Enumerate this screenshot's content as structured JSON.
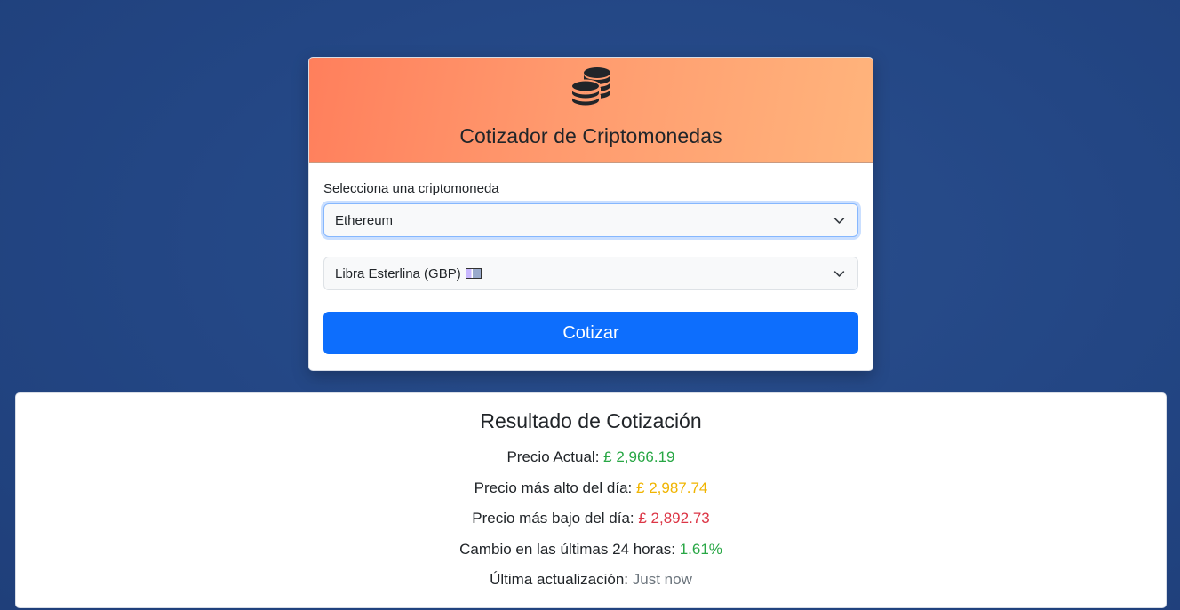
{
  "form": {
    "title": "Cotizador de Criptomonedas",
    "icon": "coins-icon",
    "crypto_label": "Selecciona una criptomoneda",
    "crypto_selected": "Ethereum",
    "currency_selected": "Libra Esterlina (GBP)",
    "submit_label": "Cotizar"
  },
  "result": {
    "title": "Resultado de Cotización",
    "rows": [
      {
        "label": "Precio Actual:",
        "value": "£ 2,966.19",
        "color": "#28a745"
      },
      {
        "label": "Precio más alto del día:",
        "value": "£ 2,987.74",
        "color": "#f0b400"
      },
      {
        "label": "Precio más bajo del día:",
        "value": "£ 2,892.73",
        "color": "#dc3545"
      },
      {
        "label": "Cambio en las últimas 24 horas:",
        "value": "1.61%",
        "color": "#28a745"
      },
      {
        "label": "Última actualización:",
        "value": "Just now",
        "color": "#6c757d"
      }
    ]
  },
  "colors": {
    "primary": "#0d6efd",
    "background": "#234684",
    "header_gradient_start": "#ff7f5c",
    "header_gradient_end": "#ffb47c"
  }
}
